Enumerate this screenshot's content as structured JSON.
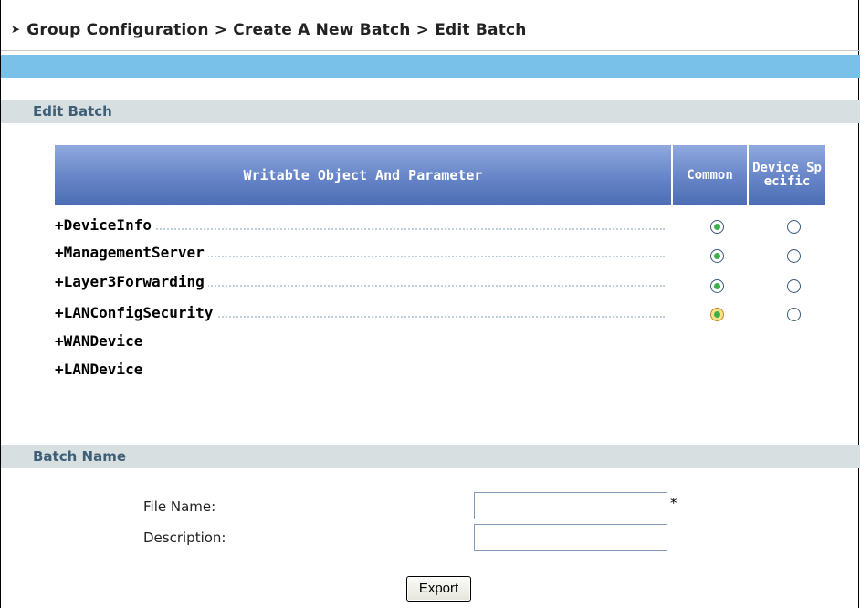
{
  "breadcrumb": "Group Configuration > Create A New Batch > Edit Batch",
  "edit_batch": {
    "section_title": "Edit Batch",
    "table": {
      "headers": [
        "Writable Object And Parameter",
        "Common",
        "Device Specific"
      ],
      "rows": [
        {
          "name": "+DeviceInfo",
          "choice": "Common"
        },
        {
          "name": "+ManagementServer",
          "choice": "Common"
        },
        {
          "name": "+Layer3Forwarding",
          "choice": "Common"
        },
        {
          "name": "+LANConfigSecurity",
          "choice": "Common"
        },
        {
          "name": "+WANDevice"
        },
        {
          "name": "+LANDevice"
        }
      ]
    }
  },
  "batch_name": {
    "section_title": "Batch Name",
    "file_name_label": "File Name:",
    "file_name_value": "",
    "required_mark": "*",
    "description_label": "Description:",
    "description_value": "",
    "export_label": "Export"
  },
  "colors": {
    "accent_bar": "#79c1e8",
    "section_header_bg": "#d8dfe1",
    "table_header": "#6987c9"
  }
}
